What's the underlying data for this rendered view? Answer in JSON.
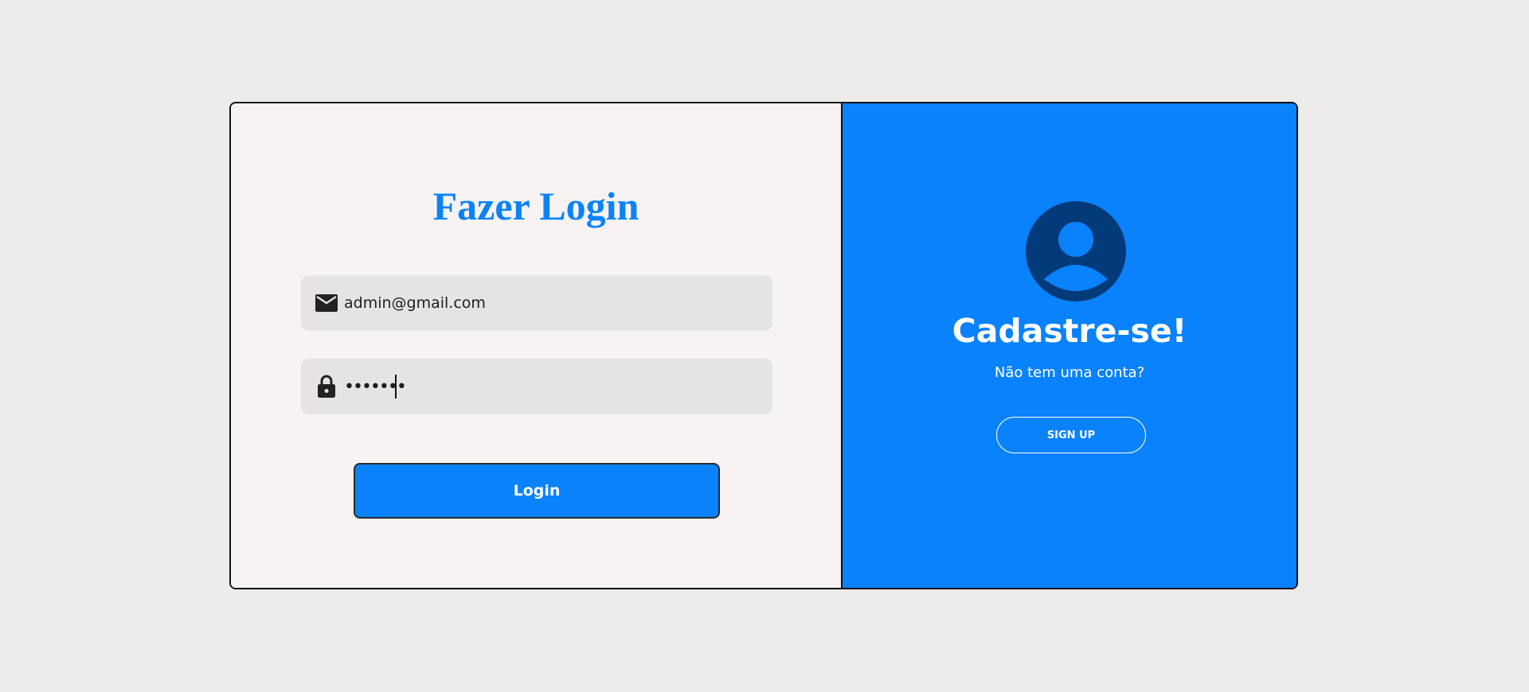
{
  "login": {
    "title": "Fazer Login",
    "email_value": "admin@gmail.com",
    "email_icon": "envelope-icon",
    "password_value": "•••••••",
    "password_icon": "lock-icon",
    "button_label": "Login"
  },
  "signup": {
    "avatar_icon": "user-circle-icon",
    "title": "Cadastre-se!",
    "subtitle": "Não tem uma conta?",
    "button_label": "SIGN UP"
  },
  "colors": {
    "accent": "#0a82fb",
    "avatar_dark": "#033b7a",
    "background": "#edecea",
    "panel_light": "#f6f3f2",
    "field_bg": "#e5e4e2"
  }
}
